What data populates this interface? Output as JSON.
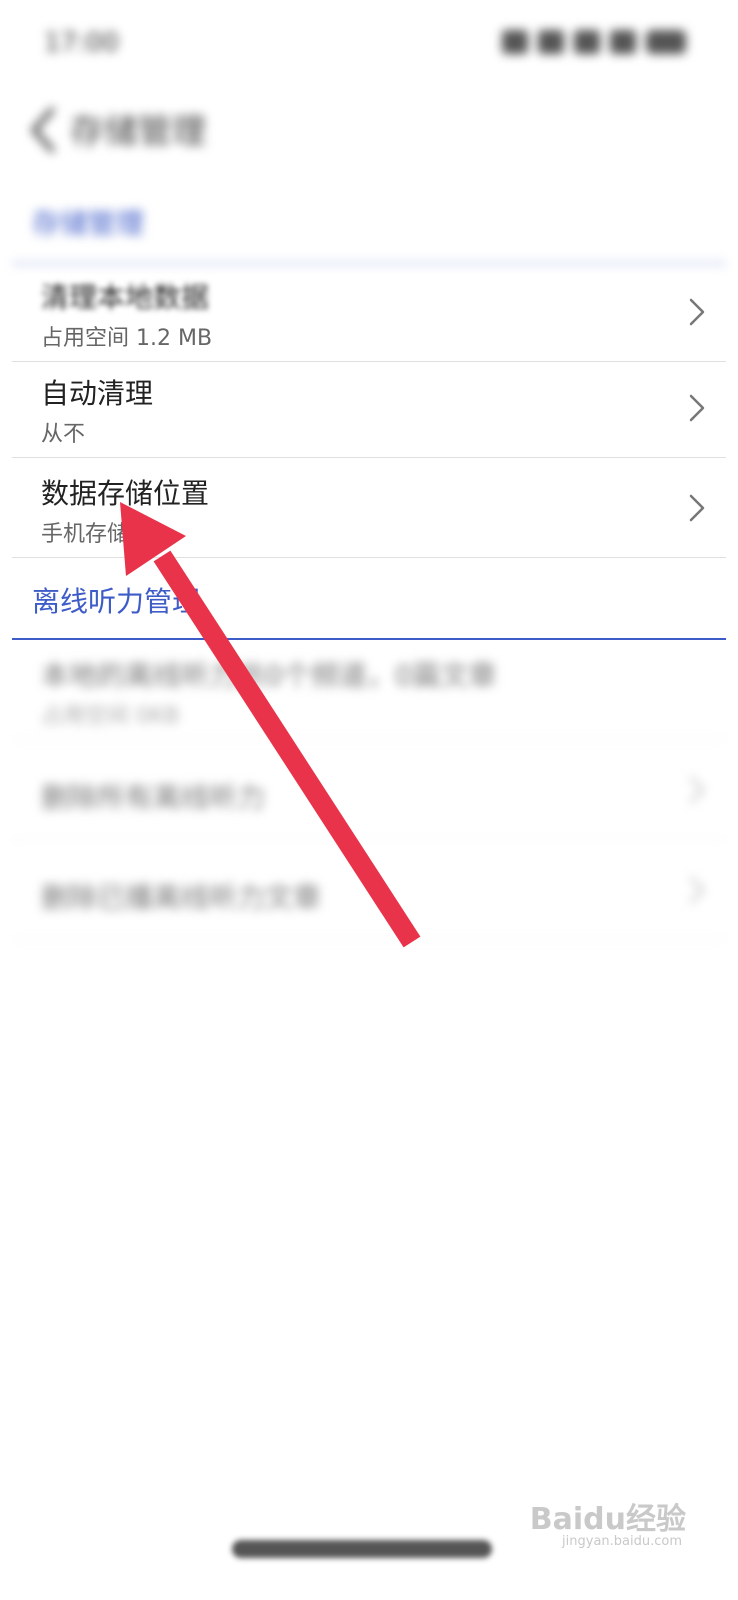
{
  "status_bar": {
    "time": "17:00"
  },
  "header": {
    "title": "存储管理"
  },
  "sections": {
    "storage": {
      "title": "存储管理",
      "items": [
        {
          "title": "清理本地数据",
          "subtitle": "占用空间 1.2 MB"
        },
        {
          "title": "自动清理",
          "subtitle": "从不"
        },
        {
          "title": "数据存储位置",
          "subtitle": "手机存储"
        }
      ]
    },
    "offline": {
      "title": "离线听力管理",
      "items": [
        {
          "title": "本地的离线听力共0个频道，0篇文章",
          "subtitle": "占用空间 0KB"
        },
        {
          "title": "删除所有离线听力"
        },
        {
          "title": "删除已播离线听力文章"
        }
      ]
    }
  },
  "watermark": {
    "brand": "Baidu经验",
    "url": "jingyan.baidu.com"
  },
  "colors": {
    "accent": "#3e5cc8",
    "annotation_arrow": "#e8334a"
  }
}
